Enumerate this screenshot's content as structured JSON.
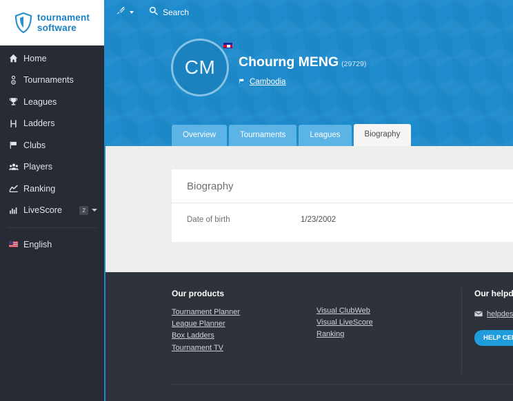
{
  "brand": {
    "logo_line1": "tournament",
    "logo_line2": "software",
    "icon": "shield-icon",
    "accent": "#1e8bcd"
  },
  "sidebar": {
    "items": [
      {
        "label": "Home",
        "icon": "home-icon"
      },
      {
        "label": "Tournaments",
        "icon": "medal-icon"
      },
      {
        "label": "Leagues",
        "icon": "trophy-icon"
      },
      {
        "label": "Ladders",
        "icon": "ladder-icon"
      },
      {
        "label": "Clubs",
        "icon": "flag-icon"
      },
      {
        "label": "Players",
        "icon": "users-icon"
      },
      {
        "label": "Ranking",
        "icon": "chart-line-icon"
      },
      {
        "label": "LiveScore",
        "icon": "livescore-bars-icon",
        "badge": "2",
        "caret": true
      }
    ],
    "language": {
      "label": "English",
      "icon": "us-flag-icon"
    }
  },
  "topbar": {
    "sport_icon": "shuttlecock-icon",
    "search_icon": "search-icon",
    "search_label": "Search"
  },
  "profile": {
    "initials": "CM",
    "name": "Chourng MENG",
    "player_id": "(29729)",
    "country": "Cambodia",
    "country_flag_icon": "cambodia-flag-icon"
  },
  "tabs": [
    {
      "label": "Overview",
      "active": false
    },
    {
      "label": "Tournaments",
      "active": false
    },
    {
      "label": "Leagues",
      "active": false
    },
    {
      "label": "Biography",
      "active": true
    }
  ],
  "card": {
    "title": "Biography",
    "rows": [
      {
        "label": "Date of birth",
        "value": "1/23/2002"
      }
    ]
  },
  "footer": {
    "products_title": "Our products",
    "products_col1": [
      "Tournament Planner",
      "League Planner",
      "Box Ladders",
      "Tournament TV"
    ],
    "products_col2": [
      "Visual ClubWeb",
      "Visual LiveScore",
      "Ranking"
    ],
    "helpdesk_title": "Our helpdesk",
    "helpdesk_email": "helpdesk@tou",
    "help_button": "HELP CENTER",
    "mail_icon": "envelope-icon"
  }
}
